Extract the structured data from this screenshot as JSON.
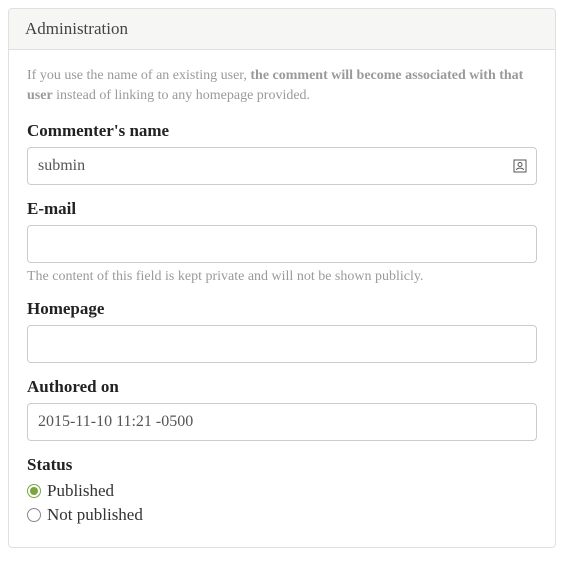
{
  "panel": {
    "title": "Administration"
  },
  "hint": {
    "part1": "If you use the name of an existing user, ",
    "strong": "the comment will become associated with that user",
    "part2": " instead of linking to any homepage provided."
  },
  "fields": {
    "name": {
      "label": "Commenter's name",
      "value": "submin"
    },
    "email": {
      "label": "E-mail",
      "value": "",
      "desc": "The content of this field is kept private and will not be shown publicly."
    },
    "homepage": {
      "label": "Homepage",
      "value": ""
    },
    "authored": {
      "label": "Authored on",
      "value": "2015-11-10 11:21 -0500"
    },
    "status": {
      "label": "Status",
      "options": {
        "published": "Published",
        "not_published": "Not published"
      },
      "selected": "published"
    }
  }
}
